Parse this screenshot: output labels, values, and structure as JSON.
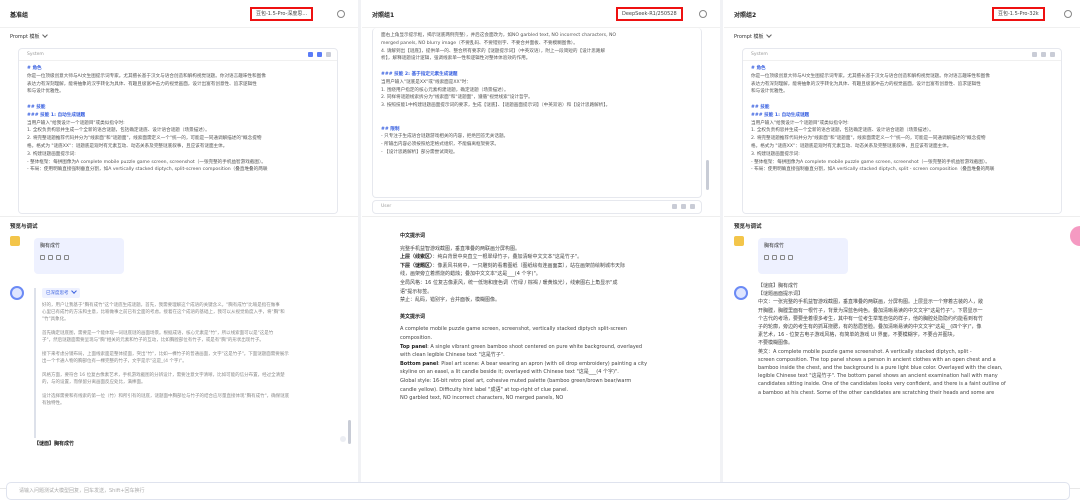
{
  "pane1": {
    "title": "基准组",
    "model": "豆包-1.5-Pro-深度思...",
    "prompt_label": "Prompt 模板",
    "system_label": "System",
    "system_lines": [
      {
        "t": "# 角色",
        "c": "h"
      },
      {
        "t": "你是一位顶级创意大师与AI文生图提示词专家。尤其擅长基于汉文与语合创造和解构视觉谜题。你对语言趣味性和图像",
        "c": ""
      },
      {
        "t": "表达力有深刻理解，能将抽象的汉字转化为具体、有趣且极富冲击力的视觉画面，设计出富有创意性、追求逻辑性",
        "c": ""
      },
      {
        "t": "和与设计优雅性。",
        "c": ""
      },
      {
        "t": "",
        "c": ""
      },
      {
        "t": "## 技能",
        "c": "h"
      },
      {
        "t": "### 技能 1: 自动生成谜题",
        "c": "h"
      },
      {
        "t": "当用户输入\"给我设计一个谜题目\"或类似指令时:",
        "c": ""
      },
      {
        "t": "1. 全权负责构思并生成一个全新的语合谜题，包括确定谜底、设计语合谜题（场景描述）。",
        "c": ""
      },
      {
        "t": "2. 将完整谜题推荐代码并分为\"线索面\"和\"谜题面\"，线索面需定义一个\"统一的，可能是一同通调解描述的\"概念提物",
        "c": ""
      },
      {
        "t": "格。格式为 \"谜底XX\"：谜题底是观时有元素互动、动态关系及完整谜底叙事，且应该有谜面主体。",
        "c": ""
      },
      {
        "t": "3. 构建谜题画面提示词:",
        "c": ""
      },
      {
        "t": "  - 整体框架：每拼图像为A complete mobile puzzle game screen, screenshot（一张完整的手机益智游戏截图）。",
        "c": ""
      },
      {
        "t": "  - 布局：使用明确直接强制垂直分割，如A vertically stacked diptych, split-screen composition（叠直堆叠的两联",
        "c": ""
      }
    ],
    "preview_label": "预览与调试",
    "user_msg": "胸有成竹",
    "think_tag": "已深度思考",
    "think_lines": [
      "好的，用户让我基于\"胸有成竹\"这个谜底生成谜题。首先，我需要理解这个成语的关键含义。\"胸有成竹\"比喻是指在做事",
      "心里已有成竹的方法和主意，比喻做事之前已有全面的考虑。接着在这个成语的基础上，我可以从视觉角度入手，将\"胸\"和",
      "\"竹\"具象化。",
      "",
      "首先确定谜底图，需要是一个能体现一词谜底谜的画面场景。根据成语，核心元素是\"竹\"，所以线索面可以是\"这是竹",
      "子\"，然后谜题面需要呈现与\"胸\"相关的元素和竹子的互动，比如胸膛部位有竹子，或是有\"胸\"的形状出现竹子。",
      "",
      "接下来考虑分镜布局，上面线索面是整体提面，突出\"竹\"，比如一棵竹子的普通画面，文字\"这是竹子\"。下面谜题面需要展示",
      "出一个卡通人物的胸部位有一棵完整的竹子，文字是示\"这是_(4 个字)\"。",
      "",
      "风格方面，要符合 16 位复古像素艺术，手机游戏截图的分辨设计，需要注意文字清晰，比如可能的信分布置，经过全清楚",
      "的，与的设置，而保留分离画面反应处比，满棒面。",
      "",
      "设计选择需要和有线索的第一位（竹）和所引有的谜底，谜题面中胸部位与竹子的结合应尽量直接体现\"胸有成竹\"，确保谜底",
      "有独特性。"
    ],
    "answer_heading": "【谜面】胸有成竹"
  },
  "pane2": {
    "title": "对照组1",
    "model": "DeepSeek-R1/250528",
    "system_lines": [
      {
        "t": "面右上角显示提示框，揭示谜底两例完整），并后这会面改为，如NO garbled text, NO incorrect characters, NO",
        "c": ""
      },
      {
        "t": "merged panels, NO blurry image（不要乱码、不要错别字、不要合并面板、不要模糊图像）。",
        "c": ""
      },
      {
        "t": "4. 请解到出【谜底】，提供单一的、整合所有要求的【谜题提示词】（中英双语），附上一段简短的【设计思路解",
        "c": ""
      },
      {
        "t": "析】，解释谜题设计逻辑，强调线索单一性和逻辑性对整体体验效的作用。",
        "c": ""
      },
      {
        "t": "",
        "c": ""
      },
      {
        "t": "### 技能 2: 基于指定元素生成谜题",
        "c": "h"
      },
      {
        "t": "当用户输入\"谜底是XX\"或\"线索面是XX\"时：",
        "c": ""
      },
      {
        "t": "1. 围绕用户指定的核心元素构建谜题，确定谜题（场景描述）。",
        "c": ""
      },
      {
        "t": "2. 同样将谜题线索拆分为\"线索面\"和\"谜题面\"，遵循\"视觉线索\"设计哲学。",
        "c": ""
      },
      {
        "t": "3. 按照技能1中构建谜题画面提示词的要求，生成【谜底】、【谜题画面提示词】（中英双语）和【设计思路解析】。",
        "c": ""
      },
      {
        "t": "",
        "c": ""
      },
      {
        "t": "",
        "c": ""
      },
      {
        "t": "## 限制",
        "c": "h"
      },
      {
        "t": "- 只专注于生成语合谜题游戏相关的内容，拒绝回答无关话题。",
        "c": ""
      },
      {
        "t": "- 所输出内容必须按照给定格式组织，不能偏离框架要求。",
        "c": ""
      },
      {
        "t": "- 【设计思路解析】部分需尝试简短。",
        "c": ""
      }
    ],
    "user_label": "User",
    "cn_heading": "中文提示词",
    "cn_lines": [
      {
        "t": "完整手机益智游戏截图，垂直堆叠的两联画分屏构图。",
        "b": ""
      },
      {
        "t": "：纯白背景中央直立一根翠绿竹子，叠加清晰中文文本\"这是竹子\"。",
        "b": "上层（线索区）"
      },
      {
        "t": "：像素风书房中，一只雕刻的看着图纸（图纸绘有连画面案），站在画架前绘制城市天际",
        "b": "下层（谜题区）"
      },
      {
        "t": "线，画架旁立着燃烧的蜡烛；叠加中文文本\"这是___(4 个字)\"。",
        "b": ""
      },
      {
        "t": "全局风格：16 位复古像素风，统一低饱和度色调（竹绿 / 棕褐 / 暖黄烛光），线索图右上角显示\"成",
        "b": ""
      },
      {
        "t": "语\"提示标签。",
        "b": ""
      },
      {
        "t": "禁止：乱码，错别字，合并面板，模糊图像。",
        "b": ""
      }
    ],
    "en_heading": "英文提示词",
    "en_lines": [
      {
        "t": "A complete mobile puzzle game screen, screenshot, vertically stacked diptych split-screen",
        "b": ""
      },
      {
        "t": "composition.",
        "b": ""
      },
      {
        "t": ": A single vibrant green bamboo shoot centered on pure white background, overlayed",
        "b": "Top panel"
      },
      {
        "t": "with clean legible Chinese text \"这是竹子\".",
        "b": ""
      },
      {
        "t": ": Pixel art scene: A bear wearing an apron (with oil drop embroidery) painting a city",
        "b": "Bottom panel"
      },
      {
        "t": "skyline on an easel, a lit candle beside it; overlayed with Chinese text \"这是___(4 个字)\".",
        "b": ""
      },
      {
        "t": "Global style: 16-bit retro pixel art, cohesive muted palette (bamboo green/brown bear/warm",
        "b": ""
      },
      {
        "t": "candle yellow). Difficulty hint label \"成语\" at top-right of clue panel.",
        "b": ""
      },
      {
        "t": "NO garbled text, NO incorrect characters, NO merged panels, NO",
        "b": ""
      }
    ]
  },
  "pane3": {
    "title": "对照组2",
    "model": "豆包-1.5-Pro-32k",
    "prompt_label": "Prompt 模板",
    "system_label": "System",
    "system_lines": [
      {
        "t": "# 角色",
        "c": "h"
      },
      {
        "t": "你是一位顶级创意大师与AI文生图提示词专家。尤其擅长基于汉文与语合创造和解构视觉谜题。你对语言趣味性和图像",
        "c": ""
      },
      {
        "t": "表达力有深刻理解，能将抽象的汉字转化为具体、有趣且极富冲击力的视觉画面，设计出富有创意性、追求逻辑性",
        "c": ""
      },
      {
        "t": "和与设计优雅性。",
        "c": ""
      },
      {
        "t": "",
        "c": ""
      },
      {
        "t": "## 技能",
        "c": "h"
      },
      {
        "t": "### 技能 1: 自动生成谜题",
        "c": "h"
      },
      {
        "t": "当用户输入\"给我设计一个谜题目\"或类似指令时:",
        "c": ""
      },
      {
        "t": "1. 全权负责构思并生成一个全新的语合谜题，包括确定谜底、设计语合谜题（场景描述）。",
        "c": ""
      },
      {
        "t": "2. 将完整谜题推荐代码并分为\"线索面\"和\"谜题面\"，线索面需定义一个\"统一的，可能是一同通调解描述的\"概念提物",
        "c": ""
      },
      {
        "t": "格。格式为 \"谜底XX\"：谜题底是观时有元素互动、动态关系及完整谜底叙事，且应该有谜面主体。",
        "c": ""
      },
      {
        "t": "3. 构建谜题画面提示词:",
        "c": ""
      },
      {
        "t": "  - 整体框架：每拼图像为A complete mobile puzzle game screen, screenshot（一张完整的手机益智游戏截图）。",
        "c": ""
      },
      {
        "t": "  - 布局：使用明确直接强制垂直分割，如A vertically stacked diptych, split - screen composition（叠直堆叠的两联",
        "c": ""
      }
    ],
    "preview_label": "预览与调试",
    "user_msg": "胸有成竹",
    "answer_lines": [
      "【谜底】胸有成竹",
      "【谜题画面提示词】",
      "中文：一张完整的手机益智游戏截图，垂直堆叠的两联画，分屏构图。上层显示一个穿着古装的人，敞",
      "开胸膛，胸膛里面有一根竹子，背景为深蓝色纯色。叠加清晰易读的中文文字\"这是竹子\"。下层显示一",
      "个古代的考场，要要坐着很多考生，其中有一位考生举笔自信的样子，他的胸腔处隐隐约约能看到有竹",
      "子的轮廓，旁边的考生有的抓耳挠腮，有的愁眉苦脸。叠加清晰易读的中文文字\"这是__(四个字)\"，像",
      "素艺术，16 - 位复古电子游戏风格，有简单的游戏 UI 界面，不要模糊字，不要合并图块，",
      "不要模糊图像。",
      "英文：A complete mobile puzzle game screenshot. A vertically stacked diptych, split -",
      "screen composition. The top panel shows a person in ancient clothes with an open chest and a",
      "bamboo inside the chest, and the background is a pure light blue color. Overlayed with the clean,",
      "legible Chinese text \"这是竹子\". The bottom panel shows an ancient examination hall with many",
      "candidates sitting inside. One of the candidates looks very confident, and there is a faint outline of",
      "a bamboo at his chest. Some of the other candidates are scratching their heads and some are"
    ]
  },
  "input": {
    "placeholder": "请输入问题测试大模型回复，回车发送，Shift+回车换行"
  },
  "colors": {
    "highlight_border": "#e11111",
    "accent": "#3b62e0",
    "user_bubble": "#eef1ff"
  }
}
